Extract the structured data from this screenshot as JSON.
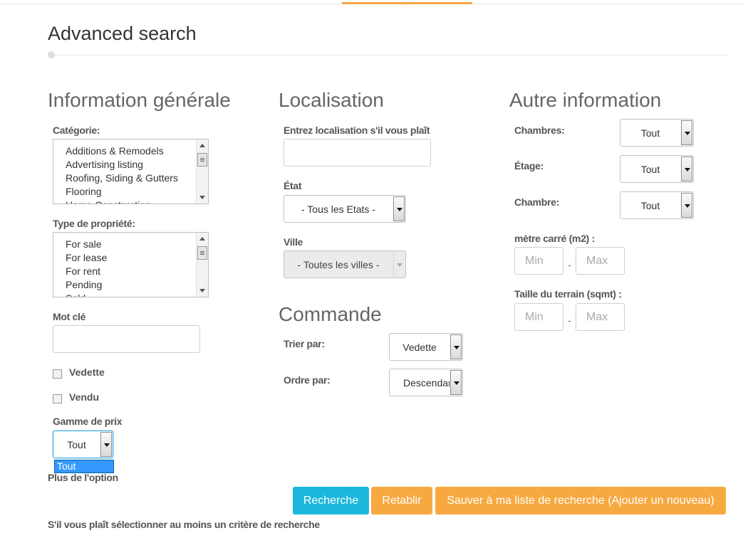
{
  "page": {
    "title": "Advanced search"
  },
  "general": {
    "heading": "Information générale",
    "category": {
      "label": "Catégorie:",
      "options": [
        "Additions & Remodels",
        "Advertising listing",
        "Roofing, Siding & Gutters",
        "Flooring",
        "Home Construction"
      ]
    },
    "property_type": {
      "label": "Type de propriété:",
      "options": [
        "For sale",
        "For lease",
        "For rent",
        "Pending",
        "Sold"
      ]
    },
    "keyword": {
      "label": "Mot clé",
      "value": ""
    },
    "featured": {
      "label": "Vedette",
      "checked": false
    },
    "sold": {
      "label": "Vendu",
      "checked": false
    },
    "price_range": {
      "label": "Gamme de prix",
      "selected": "Tout",
      "open_option": "Tout"
    },
    "more_options": "Plus de l'option"
  },
  "location": {
    "heading": "Localisation",
    "input_label": "Entrez localisation s'il vous plaît",
    "input_value": "",
    "state": {
      "label": "État",
      "selected": "- Tous les Etats -"
    },
    "city": {
      "label": "Ville",
      "selected": "- Toutes les villes -"
    }
  },
  "order": {
    "heading": "Commande",
    "sort_by": {
      "label": "Trier par:",
      "selected": "Vedette"
    },
    "order_by": {
      "label": "Ordre par:",
      "selected": "Descendant"
    }
  },
  "other": {
    "heading": "Autre information",
    "bedrooms": {
      "label": "Chambres:",
      "selected": "Tout"
    },
    "floor": {
      "label": "Étage:",
      "selected": "Tout"
    },
    "room": {
      "label": "Chambre:",
      "selected": "Tout"
    },
    "square_meters": {
      "label": "mètre carré (m2) :",
      "min_placeholder": "Min",
      "max_placeholder": "Max",
      "separator": "-"
    },
    "lot_size": {
      "label": "Taille du terrain (sqmt) :",
      "min_placeholder": "Min",
      "max_placeholder": "Max",
      "separator": "-"
    }
  },
  "actions": {
    "search": "Recherche",
    "reset": "Retablir",
    "save": "Sauver à ma liste de recherche (Ajouter un nouveau)"
  },
  "footer_note": "S'il vous plaît sélectionner au moins un critère de recherche",
  "colors": {
    "accent": "#f4a640",
    "primary_button": "#1cb8db",
    "warning_button": "#f7a940",
    "highlight": "#3399ff"
  }
}
